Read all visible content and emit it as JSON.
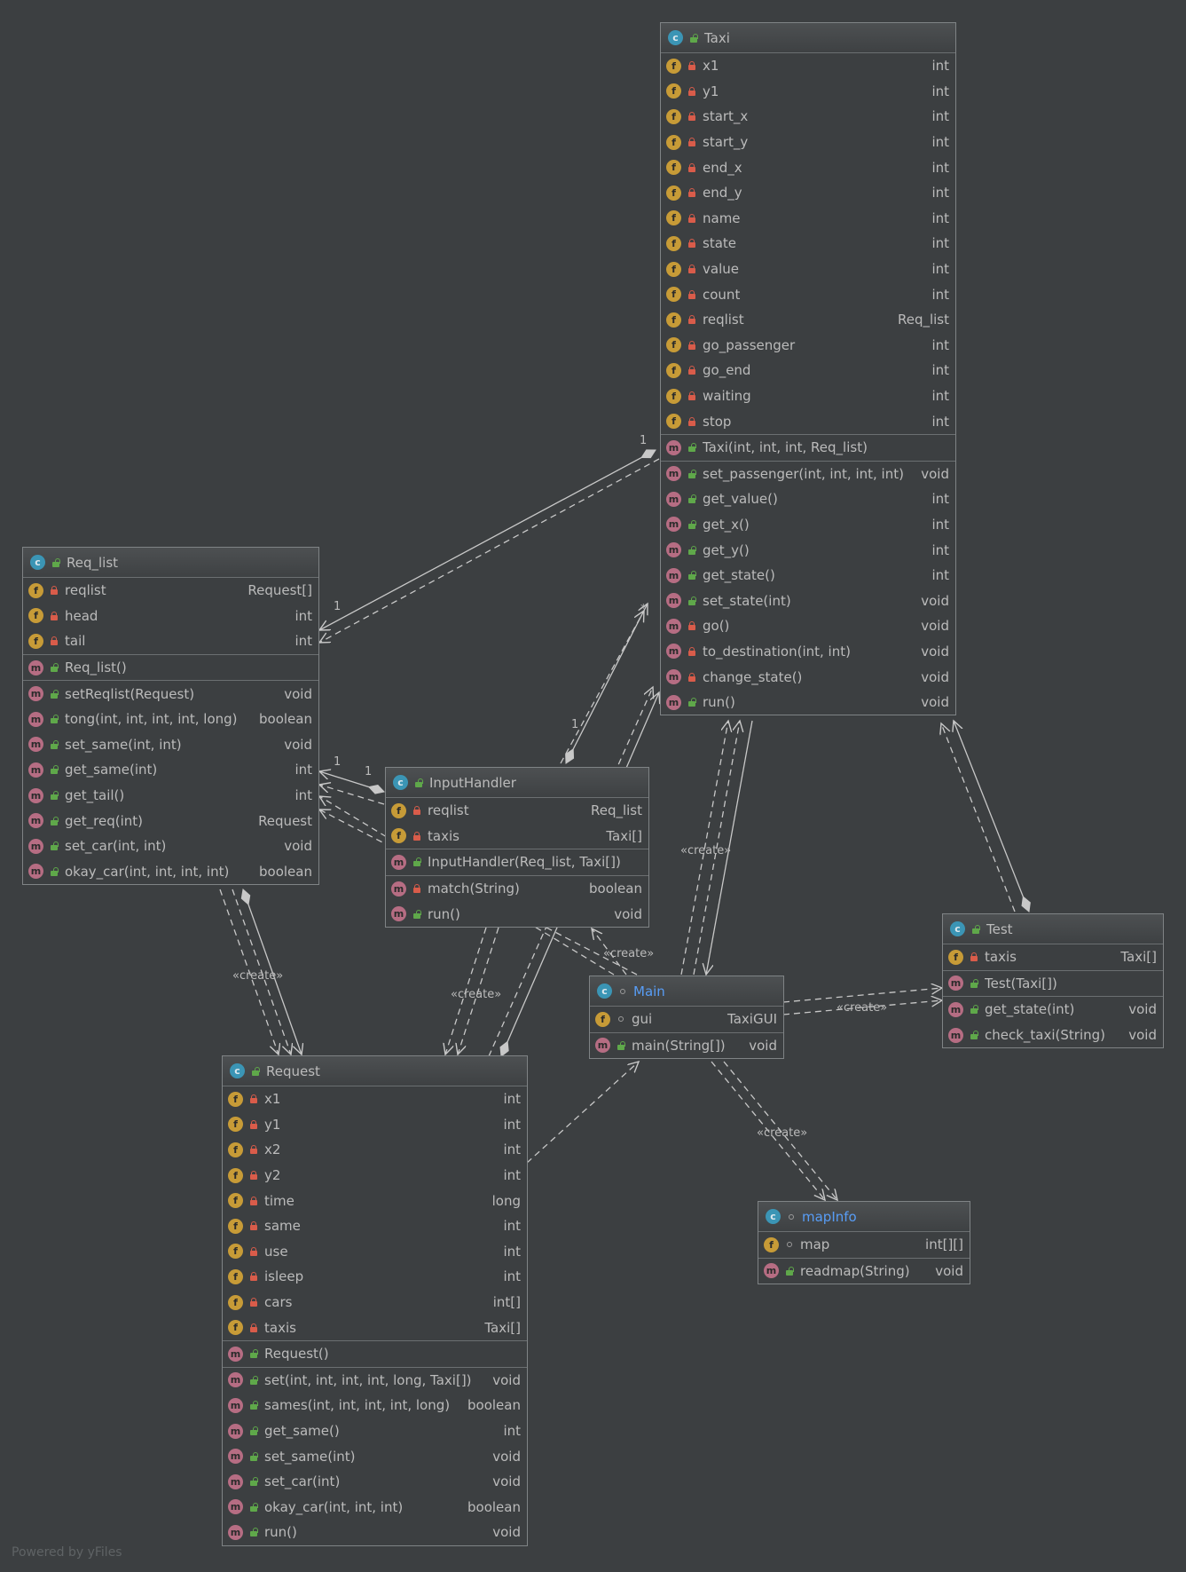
{
  "watermark": "Powered by yFiles",
  "create_label": "«create»",
  "colors": {
    "background": "#3c3f41",
    "field_icon": "#c79b37",
    "method_icon": "#b66d83",
    "class_icon": "#3b95b5",
    "private_lock": "#d95c4a",
    "public_lock": "#5fa84a",
    "accent_title": "#589df6",
    "edge": "#c8c8c8"
  },
  "classes": {
    "taxi": {
      "name": "Taxi",
      "fields": [
        {
          "name": "x1",
          "type": "int",
          "visibility": "private"
        },
        {
          "name": "y1",
          "type": "int",
          "visibility": "private"
        },
        {
          "name": "start_x",
          "type": "int",
          "visibility": "private"
        },
        {
          "name": "start_y",
          "type": "int",
          "visibility": "private"
        },
        {
          "name": "end_x",
          "type": "int",
          "visibility": "private"
        },
        {
          "name": "end_y",
          "type": "int",
          "visibility": "private"
        },
        {
          "name": "name",
          "type": "int",
          "visibility": "private"
        },
        {
          "name": "state",
          "type": "int",
          "visibility": "private"
        },
        {
          "name": "value",
          "type": "int",
          "visibility": "private"
        },
        {
          "name": "count",
          "type": "int",
          "visibility": "private"
        },
        {
          "name": "reqlist",
          "type": "Req_list",
          "visibility": "private"
        },
        {
          "name": "go_passenger",
          "type": "int",
          "visibility": "private"
        },
        {
          "name": "go_end",
          "type": "int",
          "visibility": "private"
        },
        {
          "name": "waiting",
          "type": "int",
          "visibility": "private"
        },
        {
          "name": "stop",
          "type": "int",
          "visibility": "private"
        }
      ],
      "constructors": [
        {
          "name": "Taxi(int, int, int, Req_list)",
          "type": "",
          "visibility": "public"
        }
      ],
      "methods": [
        {
          "name": "set_passenger(int, int, int, int)",
          "type": "void",
          "visibility": "public"
        },
        {
          "name": "get_value()",
          "type": "int",
          "visibility": "public"
        },
        {
          "name": "get_x()",
          "type": "int",
          "visibility": "public"
        },
        {
          "name": "get_y()",
          "type": "int",
          "visibility": "public"
        },
        {
          "name": "get_state()",
          "type": "int",
          "visibility": "public"
        },
        {
          "name": "set_state(int)",
          "type": "void",
          "visibility": "public"
        },
        {
          "name": "go()",
          "type": "void",
          "visibility": "private"
        },
        {
          "name": "to_destination(int, int)",
          "type": "void",
          "visibility": "private"
        },
        {
          "name": "change_state()",
          "type": "void",
          "visibility": "private"
        },
        {
          "name": "run()",
          "type": "void",
          "visibility": "public"
        }
      ]
    },
    "req_list": {
      "name": "Req_list",
      "fields": [
        {
          "name": "reqlist",
          "type": "Request[]",
          "visibility": "private"
        },
        {
          "name": "head",
          "type": "int",
          "visibility": "private"
        },
        {
          "name": "tail",
          "type": "int",
          "visibility": "private"
        }
      ],
      "constructors": [
        {
          "name": "Req_list()",
          "type": "",
          "visibility": "public"
        }
      ],
      "methods": [
        {
          "name": "setReqlist(Request)",
          "type": "void",
          "visibility": "public"
        },
        {
          "name": "tong(int, int, int, int, long)",
          "type": "boolean",
          "visibility": "public"
        },
        {
          "name": "set_same(int, int)",
          "type": "void",
          "visibility": "public"
        },
        {
          "name": "get_same(int)",
          "type": "int",
          "visibility": "public"
        },
        {
          "name": "get_tail()",
          "type": "int",
          "visibility": "public"
        },
        {
          "name": "get_req(int)",
          "type": "Request",
          "visibility": "public"
        },
        {
          "name": "set_car(int, int)",
          "type": "void",
          "visibility": "public"
        },
        {
          "name": "okay_car(int, int, int, int)",
          "type": "boolean",
          "visibility": "public"
        }
      ]
    },
    "input_handler": {
      "name": "InputHandler",
      "fields": [
        {
          "name": "reqlist",
          "type": "Req_list",
          "visibility": "private"
        },
        {
          "name": "taxis",
          "type": "Taxi[]",
          "visibility": "private"
        }
      ],
      "constructors": [
        {
          "name": "InputHandler(Req_list, Taxi[])",
          "type": "",
          "visibility": "public"
        }
      ],
      "methods": [
        {
          "name": "match(String)",
          "type": "boolean",
          "visibility": "private"
        },
        {
          "name": "run()",
          "type": "void",
          "visibility": "public"
        }
      ]
    },
    "main": {
      "name": "Main",
      "fields": [
        {
          "name": "gui",
          "type": "TaxiGUI",
          "visibility": "package"
        }
      ],
      "constructors": [],
      "methods": [
        {
          "name": "main(String[])",
          "type": "void",
          "visibility": "public"
        }
      ]
    },
    "test": {
      "name": "Test",
      "fields": [
        {
          "name": "taxis",
          "type": "Taxi[]",
          "visibility": "private"
        }
      ],
      "constructors": [
        {
          "name": "Test(Taxi[])",
          "type": "",
          "visibility": "public"
        }
      ],
      "methods": [
        {
          "name": "get_state(int)",
          "type": "void",
          "visibility": "public"
        },
        {
          "name": "check_taxi(String)",
          "type": "void",
          "visibility": "public"
        }
      ]
    },
    "request": {
      "name": "Request",
      "fields": [
        {
          "name": "x1",
          "type": "int",
          "visibility": "private"
        },
        {
          "name": "y1",
          "type": "int",
          "visibility": "private"
        },
        {
          "name": "x2",
          "type": "int",
          "visibility": "private"
        },
        {
          "name": "y2",
          "type": "int",
          "visibility": "private"
        },
        {
          "name": "time",
          "type": "long",
          "visibility": "private"
        },
        {
          "name": "same",
          "type": "int",
          "visibility": "private"
        },
        {
          "name": "use",
          "type": "int",
          "visibility": "private"
        },
        {
          "name": "isleep",
          "type": "int",
          "visibility": "private"
        },
        {
          "name": "cars",
          "type": "int[]",
          "visibility": "private"
        },
        {
          "name": "taxis",
          "type": "Taxi[]",
          "visibility": "private"
        }
      ],
      "constructors": [
        {
          "name": "Request()",
          "type": "",
          "visibility": "public"
        }
      ],
      "methods": [
        {
          "name": "set(int, int, int, int, long, Taxi[])",
          "type": "void",
          "visibility": "public"
        },
        {
          "name": "sames(int, int, int, int, long)",
          "type": "boolean",
          "visibility": "public"
        },
        {
          "name": "get_same()",
          "type": "int",
          "visibility": "public"
        },
        {
          "name": "set_same(int)",
          "type": "void",
          "visibility": "public"
        },
        {
          "name": "set_car(int)",
          "type": "void",
          "visibility": "public"
        },
        {
          "name": "okay_car(int, int, int)",
          "type": "boolean",
          "visibility": "public"
        },
        {
          "name": "run()",
          "type": "void",
          "visibility": "public"
        }
      ]
    },
    "map_info": {
      "name": "mapInfo",
      "fields": [
        {
          "name": "map",
          "type": "int[][]",
          "visibility": "package"
        }
      ],
      "constructors": [],
      "methods": [
        {
          "name": "readmap(String)",
          "type": "void",
          "visibility": "public"
        }
      ]
    }
  },
  "multiplicities": {
    "taxi_reqlist_one": "1",
    "reqlist_from_taxi_one": "1",
    "taxi_many": "*",
    "input_taxi_one": "1",
    "reqlist_from_input_one": "1",
    "input_reqlist_one": "1"
  }
}
